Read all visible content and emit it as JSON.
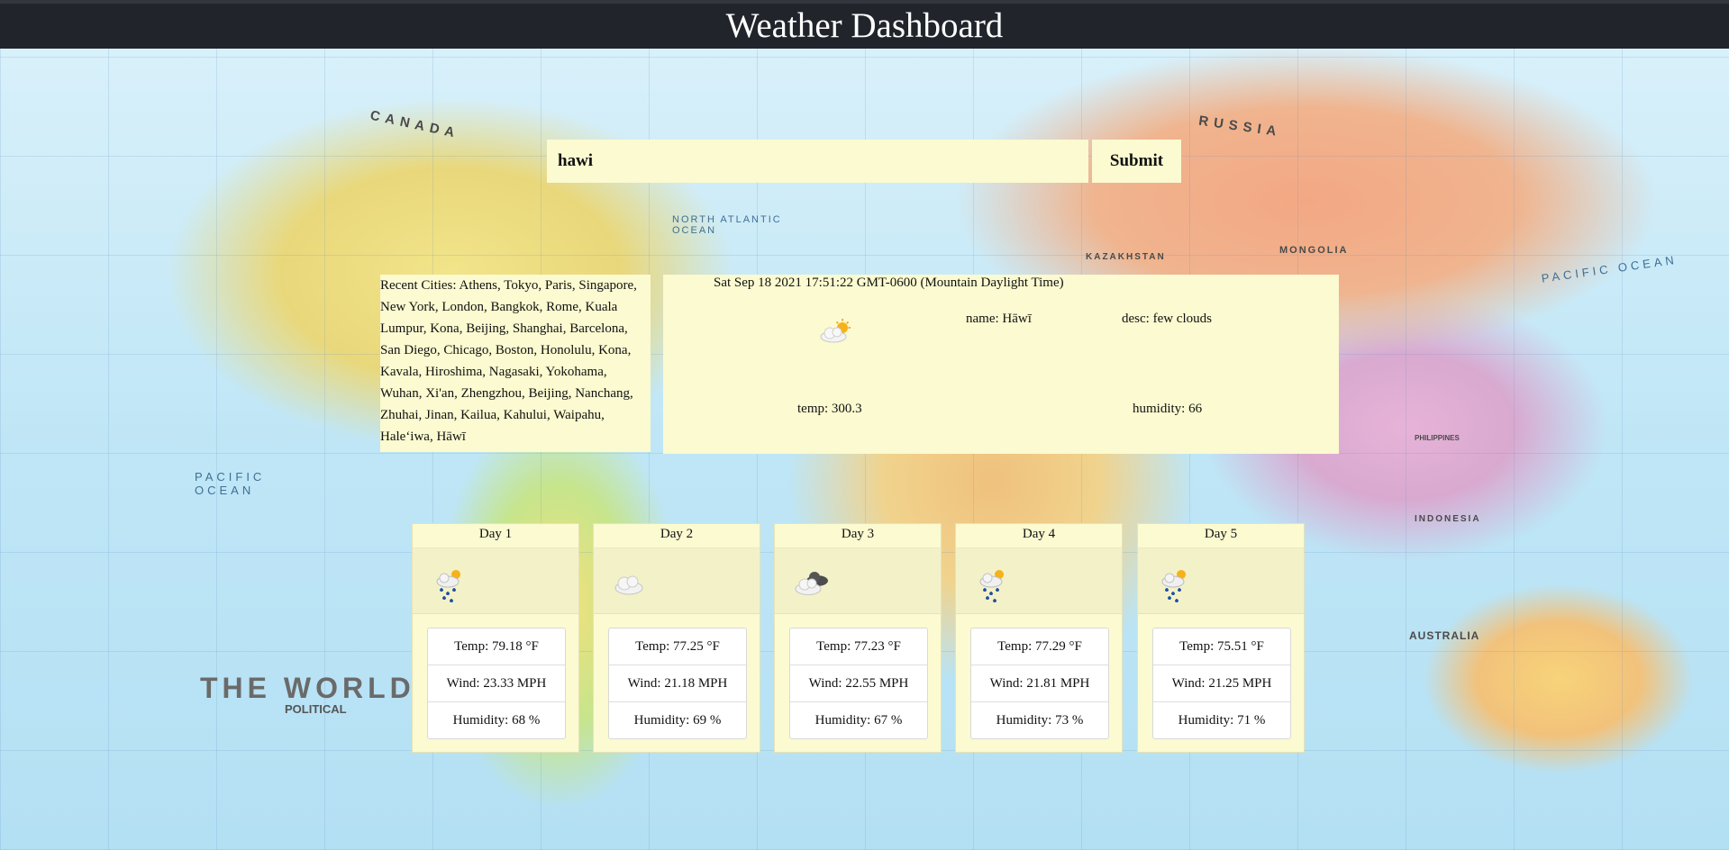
{
  "header": {
    "title": "Weather Dashboard"
  },
  "search": {
    "value": "hawi",
    "submit_label": "Submit"
  },
  "recent": {
    "label": "Recent Cities:",
    "cities": "Athens, Tokyo, Paris, Singapore, New York, London, Bangkok, Rome, Kuala Lumpur, Kona, Beijing, Shanghai, Barcelona, San Diego, Chicago, Boston, Honolulu, Kona, Kavala, Hiroshima, Nagasaki, Yokohama, Wuhan, Xi'an, Zhengzhou, Beijing, Nanchang, Zhuhai, Jinan, Kailua, Kahului, Waipahu, Haleʻiwa, Hāwī"
  },
  "current": {
    "date": "Sat Sep 18 2021 17:51:22 GMT-0600 (Mountain Daylight Time)",
    "icon": "few-clouds-day-icon",
    "name": "name: Hāwī",
    "desc": "desc: few clouds",
    "temp": "temp: 300.3",
    "humidity": "humidity: 66"
  },
  "forecast": [
    {
      "day": "Day 1",
      "icon": "rain-sun-icon",
      "temp": "Temp: 79.18 °F",
      "wind": "Wind: 23.33 MPH",
      "humidity": "Humidity: 68 %"
    },
    {
      "day": "Day 2",
      "icon": "cloud-icon",
      "temp": "Temp: 77.25 °F",
      "wind": "Wind: 21.18 MPH",
      "humidity": "Humidity: 69 %"
    },
    {
      "day": "Day 3",
      "icon": "broken-clouds-icon",
      "temp": "Temp: 77.23 °F",
      "wind": "Wind: 22.55 MPH",
      "humidity": "Humidity: 67 %"
    },
    {
      "day": "Day 4",
      "icon": "rain-sun-icon",
      "temp": "Temp: 77.29 °F",
      "wind": "Wind: 21.81 MPH",
      "humidity": "Humidity: 73 %"
    },
    {
      "day": "Day 5",
      "icon": "rain-sun-icon",
      "temp": "Temp: 75.51 °F",
      "wind": "Wind: 21.25 MPH",
      "humidity": "Humidity: 71 %"
    }
  ],
  "map": {
    "labels": [
      "CANADA",
      "RUSSIA",
      "KAZAKHSTAN",
      "MONGOLIA",
      "AUSTRALIA",
      "INDONESIA",
      "PHILIPPINES"
    ],
    "oceans": [
      "NORTH ATLANTIC OCEAN",
      "PACIFIC OCEAN",
      "PACIFIC OCEAN"
    ],
    "title": "THE WORLD",
    "subtitle": "POLITICAL"
  },
  "colors": {
    "header_bg": "#21252b",
    "panel_bg": "#fbfad0"
  }
}
